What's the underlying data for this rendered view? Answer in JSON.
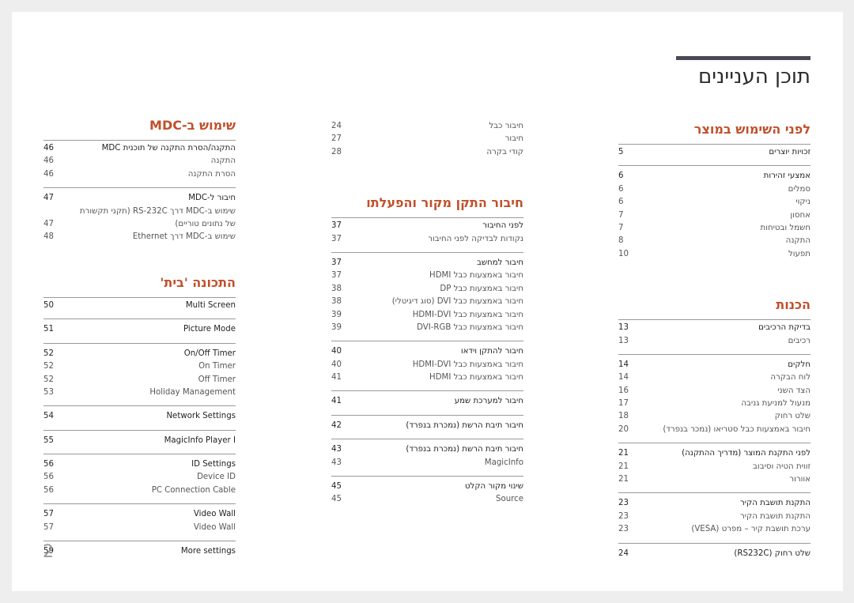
{
  "document": {
    "title": "תוכן העניינים",
    "page_number": "2",
    "accent_color": "#c1502b"
  },
  "right_column": {
    "sections": [
      {
        "title": "לפני השימוש במוצר",
        "groups": [
          [
            {
              "label": "זכויות יוצרים",
              "page": "5",
              "head": true
            }
          ],
          [
            {
              "label": "אמצעי זהירות",
              "page": "6",
              "head": true
            },
            {
              "label": "סמלים",
              "page": "6"
            },
            {
              "label": "ניקוי",
              "page": "6"
            },
            {
              "label": "אחסון",
              "page": "7"
            },
            {
              "label": "חשמל ובטיחות",
              "page": "7"
            },
            {
              "label": "התקנה",
              "page": "8"
            },
            {
              "label": "תפעול",
              "page": "10"
            }
          ]
        ]
      },
      {
        "title": "הכנות",
        "groups": [
          [
            {
              "label": "בדיקת הרכיבים",
              "page": "13",
              "head": true
            },
            {
              "label": "רכיבים",
              "page": "13"
            }
          ],
          [
            {
              "label": "חלקים",
              "page": "14",
              "head": true
            },
            {
              "label": "לוח הבקרה",
              "page": "14"
            },
            {
              "label": "הצד השני",
              "page": "16"
            },
            {
              "label": "מנעול למניעת גניבה",
              "page": "17"
            },
            {
              "label": "שלט רחוק",
              "page": "18"
            },
            {
              "label": "חיבור באמצעות כבל סטריאו (נמכר בנפרד)",
              "page": "20"
            }
          ],
          [
            {
              "label": "לפני התקנת המוצר (מדריך ההתקנה)",
              "page": "21",
              "head": true
            },
            {
              "label": "זווית הטיה וסיבוב",
              "page": "21"
            },
            {
              "label": "אוורור",
              "page": "21"
            }
          ],
          [
            {
              "label": "התקנת תושבת הקיר",
              "page": "23",
              "head": true
            },
            {
              "label": "התקנת תושבת הקיר",
              "page": "23"
            },
            {
              "label": "ערכת תושבת קיר – מפרט (VESA)",
              "page": "23"
            }
          ],
          [
            {
              "label": "שלט רחוק (RS232C)",
              "page": "24",
              "head": true
            }
          ]
        ]
      }
    ]
  },
  "middle_column": {
    "continued": [
      {
        "label": "חיבור כבל",
        "page": "24"
      },
      {
        "label": "חיבור",
        "page": "27"
      },
      {
        "label": "קודי בקרה",
        "page": "28"
      }
    ],
    "sections": [
      {
        "title": "חיבור התקן מקור והפעלתו",
        "groups": [
          [
            {
              "label": "לפני החיבור",
              "page": "37",
              "head": true
            },
            {
              "label": "נקודות לבדיקה לפני החיבור",
              "page": "37"
            }
          ],
          [
            {
              "label": "חיבור למחשב",
              "page": "37",
              "head": true
            },
            {
              "label": "חיבור באמצעות כבל HDMI",
              "page": "37"
            },
            {
              "label": "חיבור באמצעות כבל DP",
              "page": "38"
            },
            {
              "label": "חיבור באמצעות כבל DVI (סוג דיגיטלי)",
              "page": "38"
            },
            {
              "label": "חיבור באמצעות כבל HDMI-DVI",
              "page": "39"
            },
            {
              "label": "חיבור באמצעות כבל DVI-RGB",
              "page": "39"
            }
          ],
          [
            {
              "label": "חיבור להתקן וידאו",
              "page": "40",
              "head": true
            },
            {
              "label": "חיבור באמצעות כבל HDMI-DVI",
              "page": "40"
            },
            {
              "label": "חיבור באמצעות כבל HDMI",
              "page": "41"
            }
          ],
          [
            {
              "label": "חיבור למערכת שמע",
              "page": "41",
              "head": true
            }
          ],
          [
            {
              "label": "חיבור תיבת הרשת (נמכרת בנפרד)",
              "page": "42",
              "head": true
            }
          ],
          [
            {
              "label": "חיבור תיבת הרשת (נמכרת בנפרד)",
              "page": "43",
              "head": true
            },
            {
              "label": "MagicInfo",
              "page": "43"
            }
          ],
          [
            {
              "label": "שינוי מקור הקלט",
              "page": "45",
              "head": true
            },
            {
              "label": "Source",
              "page": "45"
            }
          ]
        ]
      }
    ]
  },
  "left_column": {
    "sections": [
      {
        "title": "שימוש ב-MDC",
        "groups": [
          [
            {
              "label": "התקנה/הסרת התקנה של תוכנית MDC",
              "page": "46",
              "head": true
            },
            {
              "label": "התקנה",
              "page": "46"
            },
            {
              "label": "הסרת התקנה",
              "page": "46"
            }
          ],
          [
            {
              "label": "חיבור ל-MDC",
              "page": "47",
              "head": true
            },
            {
              "label": "שימוש ב-MDC דרך RS-232C (תקני תקשורת של נתונים טוריים)",
              "page": "47",
              "two_line": true
            },
            {
              "label": "שימוש ב-MDC דרך Ethernet",
              "page": "48"
            }
          ]
        ]
      },
      {
        "title": "התכונה 'בית'",
        "groups": [
          [
            {
              "label": "Multi Screen",
              "page": "50",
              "head": true
            }
          ],
          [
            {
              "label": "Picture Mode",
              "page": "51",
              "head": true
            }
          ],
          [
            {
              "label": "On/Off Timer",
              "page": "52",
              "head": true
            },
            {
              "label": "On Timer",
              "page": "52"
            },
            {
              "label": "Off Timer",
              "page": "52"
            },
            {
              "label": "Holiday Management",
              "page": "53"
            }
          ],
          [
            {
              "label": "Network Settings",
              "page": "54",
              "head": true
            }
          ],
          [
            {
              "label": "MagicInfo Player I",
              "page": "55",
              "head": true
            }
          ],
          [
            {
              "label": "ID Settings",
              "page": "56",
              "head": true
            },
            {
              "label": "Device ID",
              "page": "56"
            },
            {
              "label": "PC Connection Cable",
              "page": "56"
            }
          ],
          [
            {
              "label": "Video Wall",
              "page": "57",
              "head": true
            },
            {
              "label": "Video Wall",
              "page": "57"
            }
          ],
          [
            {
              "label": "More settings",
              "page": "59",
              "head": true
            }
          ]
        ]
      }
    ]
  }
}
